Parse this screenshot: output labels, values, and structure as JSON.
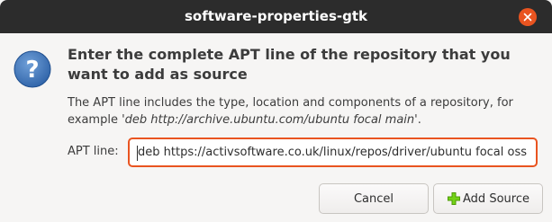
{
  "window": {
    "title": "software-properties-gtk",
    "close_icon": "close-icon"
  },
  "dialog": {
    "icon": "question-icon",
    "heading": "Enter the complete APT line of the repository that you want to add as source",
    "description_prefix": "The APT line includes the type, location and components of a repository, for example ",
    "description_example": "'deb http://archive.ubuntu.com/ubuntu focal main'",
    "description_suffix": ".",
    "apt_label": "APT line:",
    "apt_value": "deb https://activsoftware.co.uk/linux/repos/driver/ubuntu focal oss"
  },
  "buttons": {
    "cancel_label": "Cancel",
    "add_label": "Add Source",
    "add_icon": "plus-icon"
  },
  "colors": {
    "titlebar": "#2c2c2c",
    "accent": "#e95420",
    "question_icon": "#3b73b9",
    "plus_icon": "#73d216"
  }
}
